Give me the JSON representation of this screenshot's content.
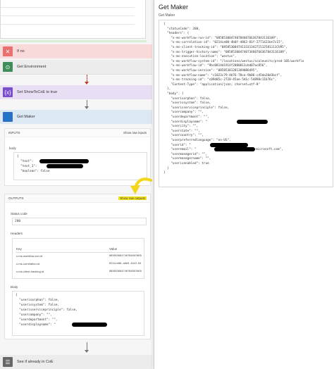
{
  "flow": {
    "if_no": "If no",
    "get_environment": "Get Environment",
    "set_show_to_coe": "Set ShowToCoE to true",
    "get_maker": "Get Maker",
    "see_if_in_coe": "See if already in CoE",
    "inputs": {
      "title": "INPUTS",
      "show_raw": "Show raw inputs",
      "body_label": "body",
      "lines": [
        "{",
        "  \"text\":",
        "  \"text_1\":",
        "  \"boolean\": false"
      ]
    },
    "outputs": {
      "title": "OUTPUTS",
      "show_raw": "Show raw outputs",
      "status_label": "Status code",
      "status_value": "200",
      "headers_label": "Headers",
      "key_col": "Key",
      "value_col": "Value",
      "header_rows": [
        {
          "key": "x-ms-workflow-run-id",
          "value": "08585300474078460766367843..."
        },
        {
          "key": "x-ms-correlation-id",
          "value": "0224ce80-a0b9-4043-84f9-2..."
        },
        {
          "key": "x-ms-client-tracking-id",
          "value": "08585300474078460766367843..."
        }
      ],
      "body_label": "Body",
      "body_lines": [
        "{",
        "  \"userisorphan\": false,",
        "  \"userissystem\": false,",
        "  \"userisserviceprinciple\": false,",
        "  \"usercompany\": \"\",",
        "  \"userdepartment\": \"\",",
        "  \"userdisplayname\": \""
      ]
    }
  },
  "pane": {
    "title": "Get Maker",
    "subtitle": "Get Maker",
    "json_lines": [
      "{",
      "  \"statusCode\": 200,",
      "  \"headers\": {",
      "    \"x-ms-workflow-run-id\": \"08585300474078460766367843116109\",",
      "    \"x-ms-correlation-id\": \"0214ce00-4b0f-4863-81f-2771421be7c15\",",
      "    \"x-ms-client-tracking-id\": \"085853004741333134271512581111CU95\",",
      "    \"x-ms-trigger-history-name\": \"08585300474073460766367843116109\",",
      "    \"x-ms-execution-location\": \"westus\",",
      "    \"x-ms-workflow-system-id\": \"/locations/westus/scaleunits/prod-105/workflo",
      "    \"x-ms-workflow-id\": \"9bc0814d1914f2808813cbd07ac856\",",
      "    \"x-ms-workflow-version\": \"08585301281369086495\",",
      "    \"x-ms-workflow-name\": \"c1023c79-4b76-78ca-9b86-c45da20d3bcf\",",
      "    \"x-ms-tracking-id\": \"c09d05c-2720-45ae-5d1c-54898c11b76c\",",
      "    \"Content-Type\": \"application/json; charset=utf-8\"",
      "  },",
      "  \"body\": {",
      "    \"userisorphan\": false,",
      "    \"userissystem\": false,",
      "    \"userisserviceprinciple\": false,",
      "    \"usercompany\": \"\",",
      "    \"userdepartment\": \"\",",
      "    \"userdisplayname\": \"",
      "    \"usercity\": \"\",",
      "    \"userstate\": \"\",",
      "    \"usercountry\": \"\",",
      "    \"userpreferredlanguage\": \"en-US\",",
      "    \"userid\": \"",
      "    \"useremail\": \"",
      "    \"usermanagerid\": \"\",",
      "    \"usermanagername\": \"\",",
      "    \"userisenabled\": true",
      "  }",
      "}"
    ],
    "email_suffix": "microsoft.com\","
  },
  "colors": {
    "if_no": "#f8dada",
    "if_no_icon": "#e8706e",
    "environment": "#ececec",
    "environment_icon": "#3f8d58",
    "variable": "#e9dff5",
    "variable_icon": "#7a4ecb",
    "maker": "#dde8f5",
    "maker_icon": "#2f6fbf",
    "highlight": "#f3e21a"
  }
}
